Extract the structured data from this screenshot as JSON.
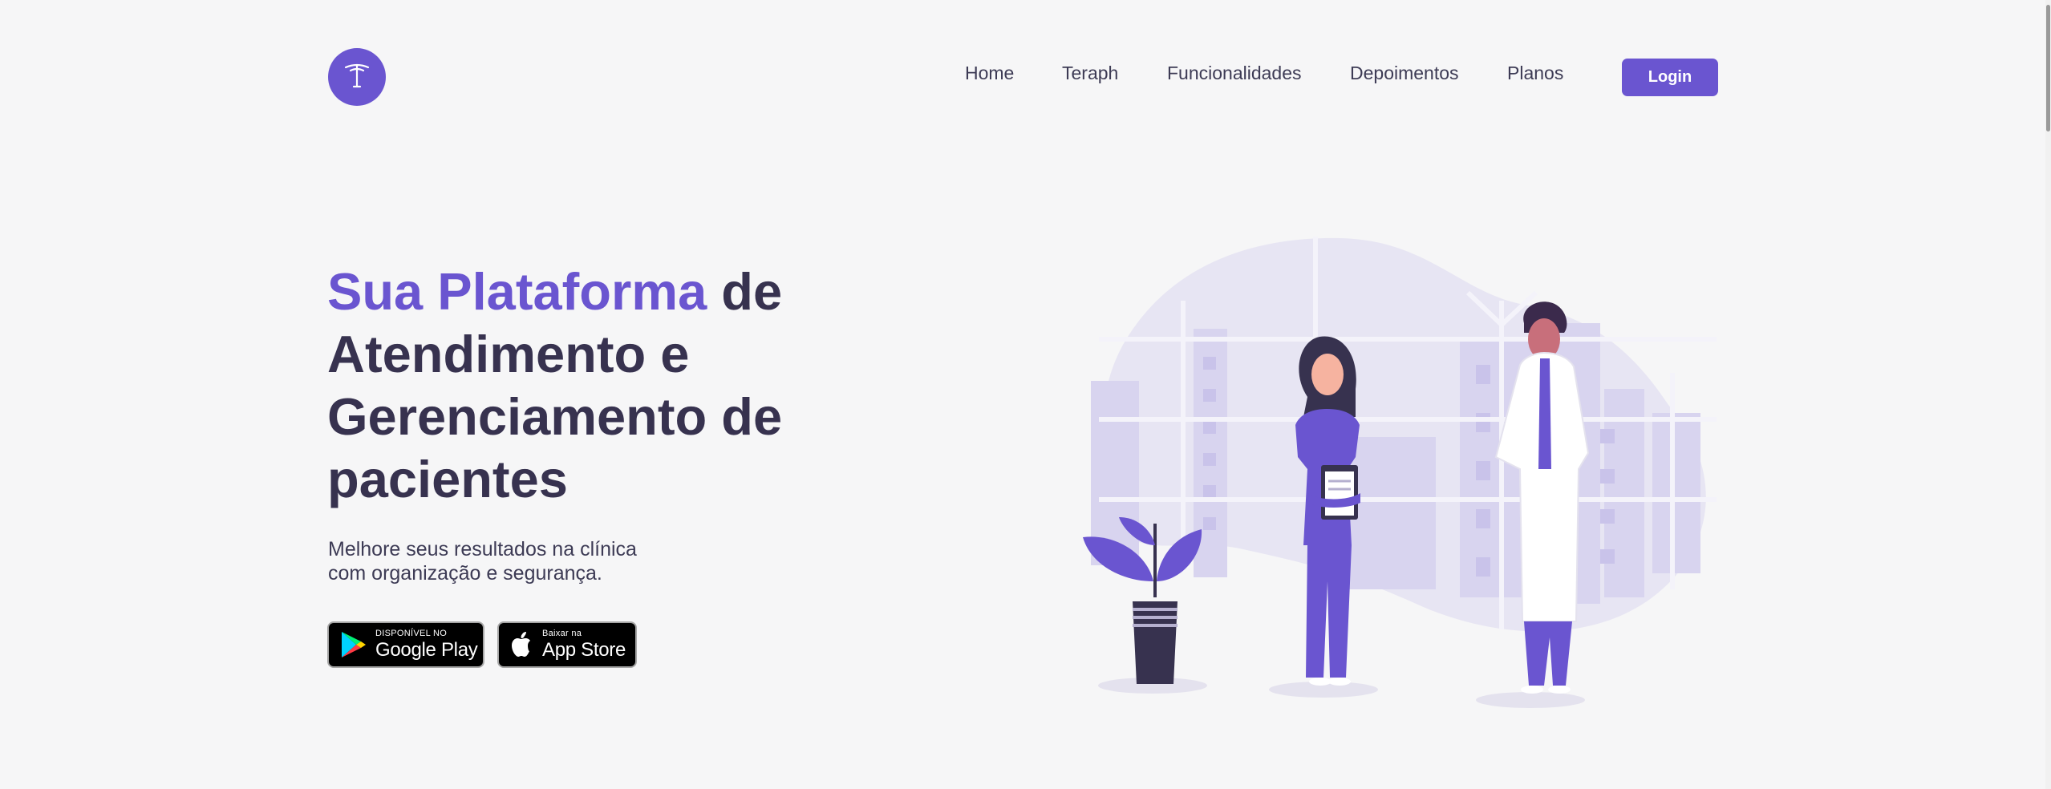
{
  "brand": {
    "logo_letter": "T",
    "accent_color": "#6a55d0",
    "dark_color": "#37324f"
  },
  "nav": {
    "items": [
      {
        "label": "Home"
      },
      {
        "label": "Teraph"
      },
      {
        "label": "Funcionalidades"
      },
      {
        "label": "Depoimentos"
      },
      {
        "label": "Planos"
      }
    ],
    "login_label": "Login"
  },
  "hero": {
    "title_accent": "Sua Plataforma",
    "title_rest": " de Atendimento e Gerenciamento de pacientes",
    "subtitle_line1": "Melhore seus resultados na clínica",
    "subtitle_line2": "com organização e segurança."
  },
  "stores": {
    "google_play": {
      "small": "DISPONÍVEL NO",
      "big": "Google Play",
      "icon": "google-play-icon"
    },
    "app_store": {
      "small": "Baixar na",
      "big": "App Store",
      "icon": "apple-icon"
    }
  }
}
